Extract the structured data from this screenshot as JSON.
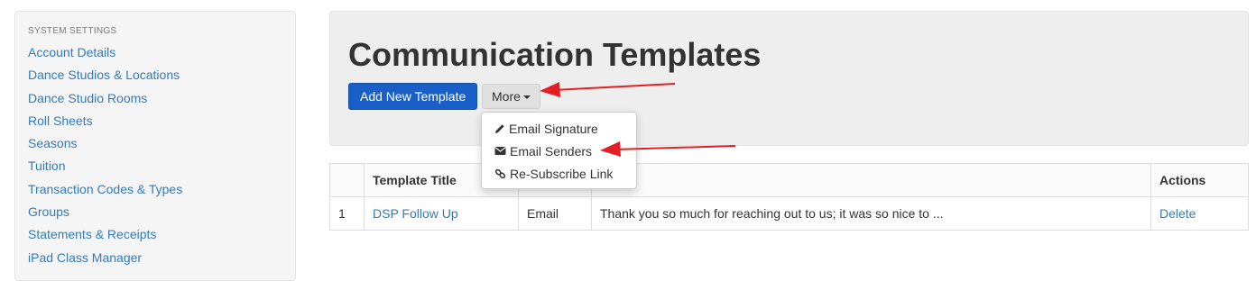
{
  "sidebar": {
    "heading": "SYSTEM SETTINGS",
    "items": [
      {
        "label": "Account Details"
      },
      {
        "label": "Dance Studios & Locations"
      },
      {
        "label": "Dance Studio Rooms"
      },
      {
        "label": "Roll Sheets"
      },
      {
        "label": "Seasons"
      },
      {
        "label": "Tuition"
      },
      {
        "label": "Transaction Codes & Types"
      },
      {
        "label": "Groups"
      },
      {
        "label": "Statements & Receipts"
      },
      {
        "label": "iPad Class Manager"
      }
    ]
  },
  "header": {
    "title": "Communication Templates",
    "add_button": "Add New Template",
    "more_button": "More"
  },
  "dropdown": {
    "items": [
      {
        "label": "Email Signature",
        "icon": "pencil-icon"
      },
      {
        "label": "Email Senders",
        "icon": "envelope-icon"
      },
      {
        "label": "Re-Subscribe Link",
        "icon": "link-icon"
      }
    ]
  },
  "table": {
    "columns": [
      "",
      "Template Title",
      "",
      "age",
      "Actions"
    ],
    "rows": [
      {
        "num": "1",
        "title": "DSP Follow Up",
        "type": "Email",
        "message": "Thank you so much for reaching out to us; it was so nice to ...",
        "action": "Delete"
      }
    ]
  },
  "colors": {
    "link": "#337ab7",
    "primary_button": "#1a5fc7",
    "annotation_arrow": "#e31e24"
  }
}
